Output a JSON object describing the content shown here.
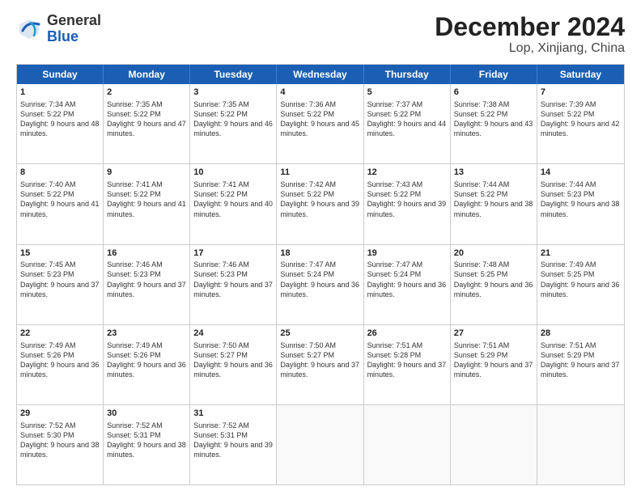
{
  "logo": {
    "general": "General",
    "blue": "Blue"
  },
  "title": "December 2024",
  "location": "Lop, Xinjiang, China",
  "days": [
    "Sunday",
    "Monday",
    "Tuesday",
    "Wednesday",
    "Thursday",
    "Friday",
    "Saturday"
  ],
  "weeks": [
    [
      {
        "day": "1",
        "sunrise": "Sunrise: 7:34 AM",
        "sunset": "Sunset: 5:22 PM",
        "daylight": "Daylight: 9 hours and 48 minutes."
      },
      {
        "day": "2",
        "sunrise": "Sunrise: 7:35 AM",
        "sunset": "Sunset: 5:22 PM",
        "daylight": "Daylight: 9 hours and 47 minutes."
      },
      {
        "day": "3",
        "sunrise": "Sunrise: 7:35 AM",
        "sunset": "Sunset: 5:22 PM",
        "daylight": "Daylight: 9 hours and 46 minutes."
      },
      {
        "day": "4",
        "sunrise": "Sunrise: 7:36 AM",
        "sunset": "Sunset: 5:22 PM",
        "daylight": "Daylight: 9 hours and 45 minutes."
      },
      {
        "day": "5",
        "sunrise": "Sunrise: 7:37 AM",
        "sunset": "Sunset: 5:22 PM",
        "daylight": "Daylight: 9 hours and 44 minutes."
      },
      {
        "day": "6",
        "sunrise": "Sunrise: 7:38 AM",
        "sunset": "Sunset: 5:22 PM",
        "daylight": "Daylight: 9 hours and 43 minutes."
      },
      {
        "day": "7",
        "sunrise": "Sunrise: 7:39 AM",
        "sunset": "Sunset: 5:22 PM",
        "daylight": "Daylight: 9 hours and 42 minutes."
      }
    ],
    [
      {
        "day": "8",
        "sunrise": "Sunrise: 7:40 AM",
        "sunset": "Sunset: 5:22 PM",
        "daylight": "Daylight: 9 hours and 41 minutes."
      },
      {
        "day": "9",
        "sunrise": "Sunrise: 7:41 AM",
        "sunset": "Sunset: 5:22 PM",
        "daylight": "Daylight: 9 hours and 41 minutes."
      },
      {
        "day": "10",
        "sunrise": "Sunrise: 7:41 AM",
        "sunset": "Sunset: 5:22 PM",
        "daylight": "Daylight: 9 hours and 40 minutes."
      },
      {
        "day": "11",
        "sunrise": "Sunrise: 7:42 AM",
        "sunset": "Sunset: 5:22 PM",
        "daylight": "Daylight: 9 hours and 39 minutes."
      },
      {
        "day": "12",
        "sunrise": "Sunrise: 7:43 AM",
        "sunset": "Sunset: 5:22 PM",
        "daylight": "Daylight: 9 hours and 39 minutes."
      },
      {
        "day": "13",
        "sunrise": "Sunrise: 7:44 AM",
        "sunset": "Sunset: 5:22 PM",
        "daylight": "Daylight: 9 hours and 38 minutes."
      },
      {
        "day": "14",
        "sunrise": "Sunrise: 7:44 AM",
        "sunset": "Sunset: 5:23 PM",
        "daylight": "Daylight: 9 hours and 38 minutes."
      }
    ],
    [
      {
        "day": "15",
        "sunrise": "Sunrise: 7:45 AM",
        "sunset": "Sunset: 5:23 PM",
        "daylight": "Daylight: 9 hours and 37 minutes."
      },
      {
        "day": "16",
        "sunrise": "Sunrise: 7:46 AM",
        "sunset": "Sunset: 5:23 PM",
        "daylight": "Daylight: 9 hours and 37 minutes."
      },
      {
        "day": "17",
        "sunrise": "Sunrise: 7:46 AM",
        "sunset": "Sunset: 5:23 PM",
        "daylight": "Daylight: 9 hours and 37 minutes."
      },
      {
        "day": "18",
        "sunrise": "Sunrise: 7:47 AM",
        "sunset": "Sunset: 5:24 PM",
        "daylight": "Daylight: 9 hours and 36 minutes."
      },
      {
        "day": "19",
        "sunrise": "Sunrise: 7:47 AM",
        "sunset": "Sunset: 5:24 PM",
        "daylight": "Daylight: 9 hours and 36 minutes."
      },
      {
        "day": "20",
        "sunrise": "Sunrise: 7:48 AM",
        "sunset": "Sunset: 5:25 PM",
        "daylight": "Daylight: 9 hours and 36 minutes."
      },
      {
        "day": "21",
        "sunrise": "Sunrise: 7:49 AM",
        "sunset": "Sunset: 5:25 PM",
        "daylight": "Daylight: 9 hours and 36 minutes."
      }
    ],
    [
      {
        "day": "22",
        "sunrise": "Sunrise: 7:49 AM",
        "sunset": "Sunset: 5:26 PM",
        "daylight": "Daylight: 9 hours and 36 minutes."
      },
      {
        "day": "23",
        "sunrise": "Sunrise: 7:49 AM",
        "sunset": "Sunset: 5:26 PM",
        "daylight": "Daylight: 9 hours and 36 minutes."
      },
      {
        "day": "24",
        "sunrise": "Sunrise: 7:50 AM",
        "sunset": "Sunset: 5:27 PM",
        "daylight": "Daylight: 9 hours and 36 minutes."
      },
      {
        "day": "25",
        "sunrise": "Sunrise: 7:50 AM",
        "sunset": "Sunset: 5:27 PM",
        "daylight": "Daylight: 9 hours and 37 minutes."
      },
      {
        "day": "26",
        "sunrise": "Sunrise: 7:51 AM",
        "sunset": "Sunset: 5:28 PM",
        "daylight": "Daylight: 9 hours and 37 minutes."
      },
      {
        "day": "27",
        "sunrise": "Sunrise: 7:51 AM",
        "sunset": "Sunset: 5:29 PM",
        "daylight": "Daylight: 9 hours and 37 minutes."
      },
      {
        "day": "28",
        "sunrise": "Sunrise: 7:51 AM",
        "sunset": "Sunset: 5:29 PM",
        "daylight": "Daylight: 9 hours and 37 minutes."
      }
    ],
    [
      {
        "day": "29",
        "sunrise": "Sunrise: 7:52 AM",
        "sunset": "Sunset: 5:30 PM",
        "daylight": "Daylight: 9 hours and 38 minutes."
      },
      {
        "day": "30",
        "sunrise": "Sunrise: 7:52 AM",
        "sunset": "Sunset: 5:31 PM",
        "daylight": "Daylight: 9 hours and 38 minutes."
      },
      {
        "day": "31",
        "sunrise": "Sunrise: 7:52 AM",
        "sunset": "Sunset: 5:31 PM",
        "daylight": "Daylight: 9 hours and 39 minutes."
      },
      null,
      null,
      null,
      null
    ]
  ]
}
